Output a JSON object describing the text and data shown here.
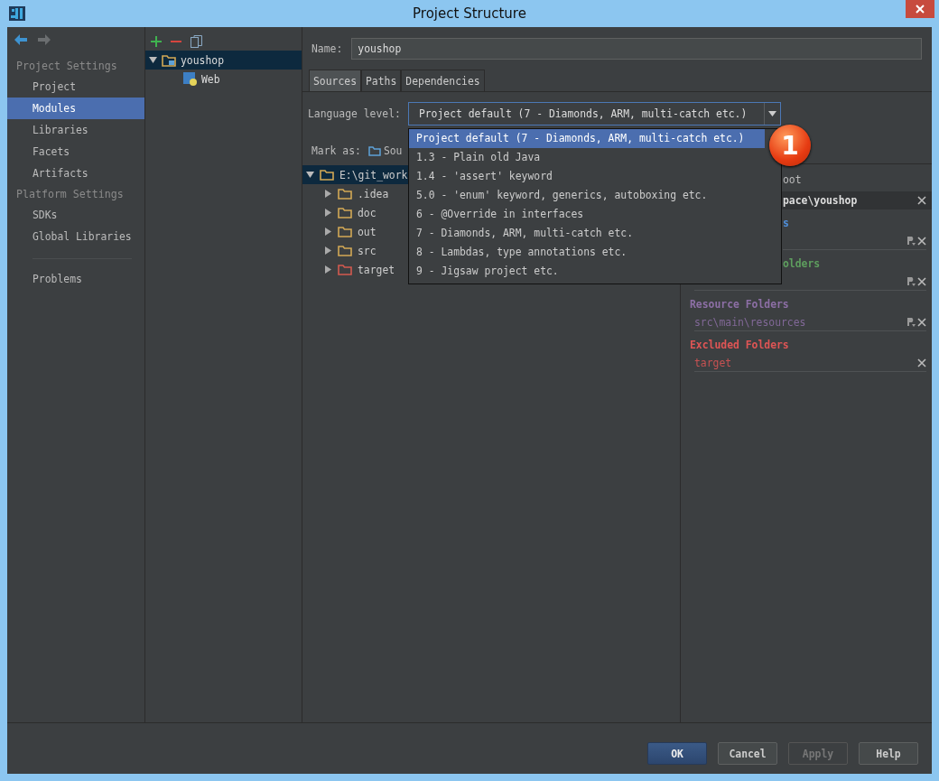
{
  "window": {
    "title": "Project Structure"
  },
  "sidebar": {
    "sections": [
      {
        "heading": "Project Settings",
        "items": [
          {
            "label": "Project",
            "selected": false
          },
          {
            "label": "Modules",
            "selected": true
          },
          {
            "label": "Libraries",
            "selected": false
          },
          {
            "label": "Facets",
            "selected": false
          },
          {
            "label": "Artifacts",
            "selected": false
          }
        ]
      },
      {
        "heading": "Platform Settings",
        "items": [
          {
            "label": "SDKs",
            "selected": false
          },
          {
            "label": "Global Libraries",
            "selected": false
          }
        ]
      }
    ],
    "extra_items": [
      {
        "label": "Problems",
        "selected": false
      }
    ]
  },
  "module_tree": [
    {
      "label": "youshop",
      "kind": "module",
      "expanded": true,
      "selected": true,
      "children": [
        {
          "label": "Web",
          "kind": "web",
          "selected": false
        }
      ]
    }
  ],
  "name_field": {
    "label": "Name:",
    "value": "youshop"
  },
  "tabs": [
    {
      "label": "Sources",
      "selected": true
    },
    {
      "label": "Paths",
      "selected": false
    },
    {
      "label": "Dependencies",
      "selected": false
    }
  ],
  "language_level": {
    "label": "Language level:",
    "value": "Project default (7 - Diamonds, ARM, multi-catch etc.)",
    "expanded": true,
    "options": [
      {
        "label": "Project default (7 - Diamonds, ARM, multi-catch etc.)",
        "selected": true
      },
      {
        "label": "1.3 - Plain old Java",
        "selected": false
      },
      {
        "label": "1.4 - 'assert' keyword",
        "selected": false
      },
      {
        "label": "5.0 - 'enum' keyword, generics, autoboxing etc.",
        "selected": false
      },
      {
        "label": "6 - @Override in interfaces",
        "selected": false
      },
      {
        "label": "7 - Diamonds, ARM, multi-catch etc.",
        "selected": false
      },
      {
        "label": "8 - Lambdas, type annotations etc.",
        "selected": false
      },
      {
        "label": "9 - Jigsaw project etc.",
        "selected": false
      }
    ]
  },
  "callout": {
    "text": "1"
  },
  "mark_as": {
    "label": "Mark as:",
    "button": "Sou"
  },
  "source_tree": {
    "label": "E:\\git_work",
    "expanded": true,
    "selected": true,
    "children": [
      {
        "label": ".idea",
        "kind": "folder",
        "expanded": false
      },
      {
        "label": "doc",
        "kind": "folder",
        "expanded": false
      },
      {
        "label": "out",
        "kind": "folder",
        "expanded": false
      },
      {
        "label": "src",
        "kind": "folder",
        "expanded": false
      },
      {
        "label": "target",
        "kind": "excluded",
        "expanded": false
      }
    ]
  },
  "content_root": {
    "add_link": "oot",
    "path": "pace\\youshop",
    "groups": [
      {
        "title": "s",
        "color": "#4f8fdb",
        "entries": [
          {
            "editable": true
          }
        ]
      },
      {
        "title": "olders",
        "color": "#5e9e5e",
        "entries": [
          {
            "editable": true
          }
        ]
      },
      {
        "title": "Resource Folders",
        "color": "#8d6fa6",
        "entries": [
          {
            "path": "src\\main\\resources",
            "editable": true
          }
        ]
      },
      {
        "title": "Excluded Folders",
        "color": "#e05555",
        "entries": [
          {
            "path": "target",
            "editable": false
          }
        ]
      }
    ]
  },
  "buttons": [
    {
      "label": "OK",
      "kind": "default",
      "disabled": false
    },
    {
      "label": "Cancel",
      "kind": "normal",
      "disabled": false
    },
    {
      "label": "Apply",
      "kind": "normal",
      "disabled": true
    },
    {
      "label": "Help",
      "kind": "normal",
      "disabled": false
    }
  ]
}
